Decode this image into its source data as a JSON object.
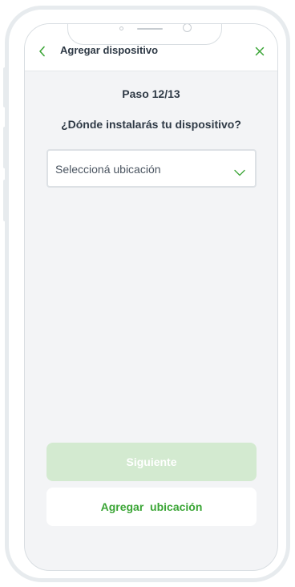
{
  "header": {
    "title": "Agregar dispositivo",
    "back_icon": "chevron-left-icon",
    "close_icon": "close-icon"
  },
  "main": {
    "step": "Paso 12/13",
    "question": "¿Dónde instalarás tu dispositivo?",
    "location_select": {
      "placeholder": "Seleccioná ubicación",
      "icon": "chevron-down-icon"
    }
  },
  "actions": {
    "next_label": "Siguiente",
    "next_enabled": false,
    "add_location_label": "Agregar  ubicación"
  },
  "colors": {
    "accent": "#3aa535",
    "accent_disabled": "#d3ead0",
    "text_primary": "#2f3a46",
    "background": "#f3f4f6"
  }
}
